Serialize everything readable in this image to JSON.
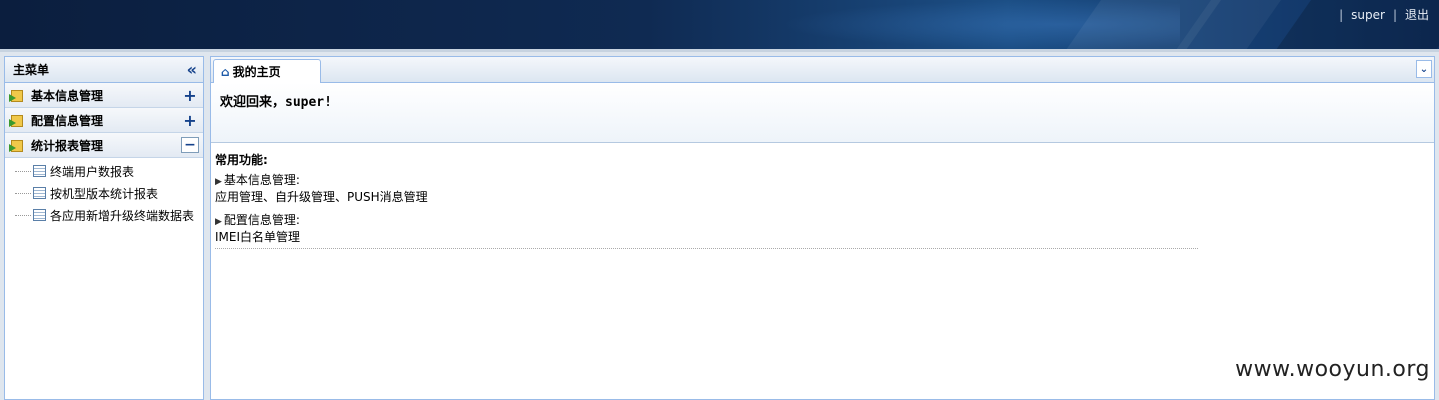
{
  "header": {
    "separator1": "|",
    "user": "super",
    "separator2": "|",
    "logout": "退出"
  },
  "sidebar": {
    "title": "主菜单",
    "collapse_glyph": "«",
    "groups": [
      {
        "label": "基本信息管理",
        "toggle": "+"
      },
      {
        "label": "配置信息管理",
        "toggle": "+"
      },
      {
        "label": "统计报表管理",
        "toggle": "−"
      }
    ],
    "report_items": [
      {
        "label": "终端用户数报表"
      },
      {
        "label": "按机型版本统计报表"
      },
      {
        "label": "各应用新增升级终端数据表"
      }
    ]
  },
  "main": {
    "tab_label": "我的主页",
    "welcome": "欢迎回来，super!",
    "common_title": "常用功能:",
    "sections": [
      {
        "title": "基本信息管理:",
        "links": "应用管理、自升级管理、PUSH消息管理"
      },
      {
        "title": "配置信息管理:",
        "links": "IMEI白名单管理"
      }
    ]
  },
  "watermark": "www.wooyun.org"
}
